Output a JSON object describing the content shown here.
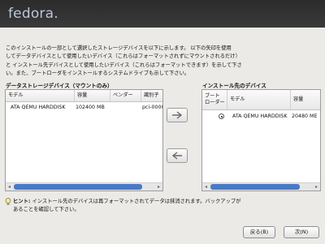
{
  "app": {
    "logo_text": "fedora."
  },
  "intro": {
    "lines": [
      "このインストールの一部として選択したストレージデバイスを以下に示します。 以下の矢印を使用",
      "してデータデバイスとして使用したいデバイス（これらはフォーマットされずにマウントされるだけ）",
      "と インストール先デバイスとして使用したいデバイス（これらはフォーマットできます）を示して下さ",
      "い。また、ブートローダをインストールするシステムドライブも示して下さい。"
    ]
  },
  "data_devices": {
    "title": "データストレージデバイス（マウントのみ）",
    "columns": [
      "モデル",
      "容量",
      "ベンダー",
      "識別子"
    ],
    "rows": [
      {
        "model": "ATA QEMU HARDDISK",
        "capacity": "102400 MB",
        "vendor": "",
        "identifier": "pci-0000"
      }
    ]
  },
  "move_buttons": {
    "to_install_icon": "arrow-right-icon",
    "to_data_icon": "arrow-left-icon"
  },
  "install_devices": {
    "title": "インストール先のデバイス",
    "columns": [
      "ブート\nローダー",
      "モデル",
      "容量"
    ],
    "rows": [
      {
        "bootloader_selected": true,
        "model": "ATA QEMU HARDDISK",
        "capacity": "20480 ME"
      }
    ]
  },
  "hint": {
    "label": "ヒント:",
    "line1": "インストール先のデバイスは再フォーマットされてデータは抹消されます。バックアップが",
    "line2": "あることを確認して下さい。"
  },
  "footer": {
    "back_label": "戻る(B)",
    "next_label": "次(N)"
  }
}
